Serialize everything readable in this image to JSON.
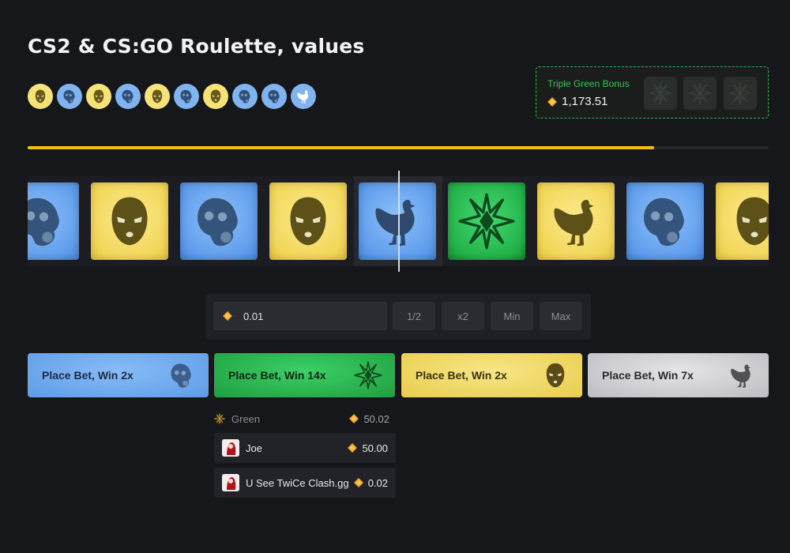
{
  "page": {
    "title": "CS2 & CS:GO Roulette, values"
  },
  "history": [
    "t",
    "ct",
    "t",
    "ct",
    "t",
    "ct",
    "t",
    "ct",
    "ct",
    "chicken"
  ],
  "bonus": {
    "label": "Triple Green Bonus",
    "amount": "1,173.51"
  },
  "round_progress": 0.845,
  "roulette": [
    "ct",
    "t",
    "ct",
    "t",
    "chicken",
    "green",
    "chicken",
    "ct",
    "t"
  ],
  "bet": {
    "amount": "0.01",
    "half_label": "1/2",
    "double_label": "x2",
    "min_label": "Min",
    "max_label": "Max"
  },
  "place_buttons": [
    {
      "label": "Place Bet, Win 2x",
      "icon": "gasmask-icon"
    },
    {
      "label": "Place Bet, Win 14x",
      "icon": "green-diamond-icon"
    },
    {
      "label": "Place Bet, Win 2x",
      "icon": "balaclava-icon"
    },
    {
      "label": "Place Bet, Win 7x",
      "icon": "chicken-icon"
    }
  ],
  "green_bets": {
    "label": "Green",
    "total": "50.02",
    "bettors": [
      {
        "name": "Joe",
        "amount": "50.00"
      },
      {
        "name": "U See TwiCe Clash.gg",
        "amount": "0.02"
      }
    ]
  },
  "colors": {
    "accent": "#f2c014",
    "blue": "#7fb4ef",
    "yellow": "#f5e37a",
    "green": "#23b24a",
    "grey": "#c9c9ce"
  }
}
